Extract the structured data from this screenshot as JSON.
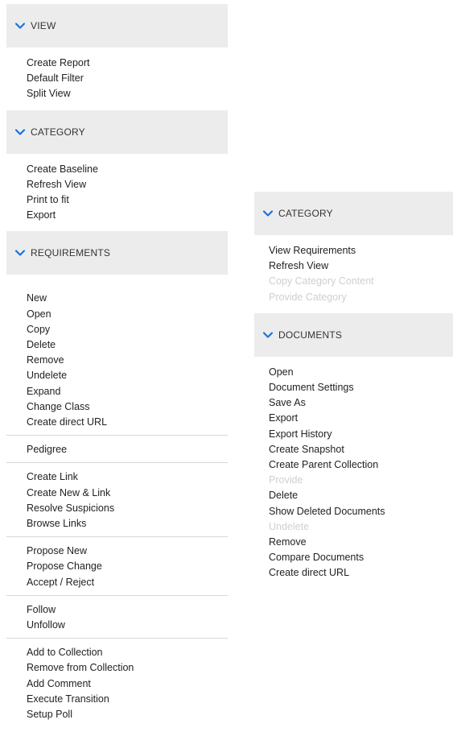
{
  "left_panel": {
    "view": {
      "title": "VIEW",
      "items": [
        "Create Report",
        "Default Filter",
        "Split View"
      ]
    },
    "category": {
      "title": "CATEGORY",
      "items": [
        "Create Baseline",
        "Refresh View",
        "Print to fit",
        "Export"
      ]
    },
    "requirements": {
      "title": "REQUIREMENTS",
      "groups": [
        [
          "New",
          "Open",
          "Copy",
          "Delete",
          "Remove",
          "Undelete",
          "Expand",
          "Change Class",
          "Create direct URL"
        ],
        [
          "Pedigree"
        ],
        [
          "Create Link",
          "Create New & Link",
          "Resolve Suspicions",
          "Browse Links"
        ],
        [
          "Propose New",
          "Propose Change",
          "Accept / Reject"
        ],
        [
          "Follow",
          "Unfollow"
        ],
        [
          "Add to Collection",
          "Remove from Collection",
          "Add Comment",
          "Execute Transition",
          "Setup Poll"
        ]
      ]
    }
  },
  "right_panel": {
    "category": {
      "title": "CATEGORY",
      "items": [
        {
          "label": "View Requirements",
          "enabled": true
        },
        {
          "label": "Refresh View",
          "enabled": true
        },
        {
          "label": "Copy Category Content",
          "enabled": false
        },
        {
          "label": "Provide Category",
          "enabled": false
        }
      ]
    },
    "documents": {
      "title": "DOCUMENTS",
      "items": [
        {
          "label": "Open",
          "enabled": true
        },
        {
          "label": "Document Settings",
          "enabled": true
        },
        {
          "label": "Save As",
          "enabled": true
        },
        {
          "label": "Export",
          "enabled": true
        },
        {
          "label": "Export History",
          "enabled": true
        },
        {
          "label": "Create Snapshot",
          "enabled": true
        },
        {
          "label": "Create Parent Collection",
          "enabled": true
        },
        {
          "label": "Provide",
          "enabled": false
        },
        {
          "label": "Delete",
          "enabled": true
        },
        {
          "label": "Show Deleted Documents",
          "enabled": true
        },
        {
          "label": "Undelete",
          "enabled": false
        },
        {
          "label": "Remove",
          "enabled": true
        },
        {
          "label": "Compare Documents",
          "enabled": true
        },
        {
          "label": "Create direct URL",
          "enabled": true
        }
      ]
    }
  },
  "colors": {
    "header_bg": "#ececed",
    "chevron": "#1a73d9",
    "text": "#222222",
    "disabled_text": "#cfcfcf",
    "divider": "#d8d8d8"
  },
  "icons": {
    "section_toggle": "chevron-down-icon"
  }
}
